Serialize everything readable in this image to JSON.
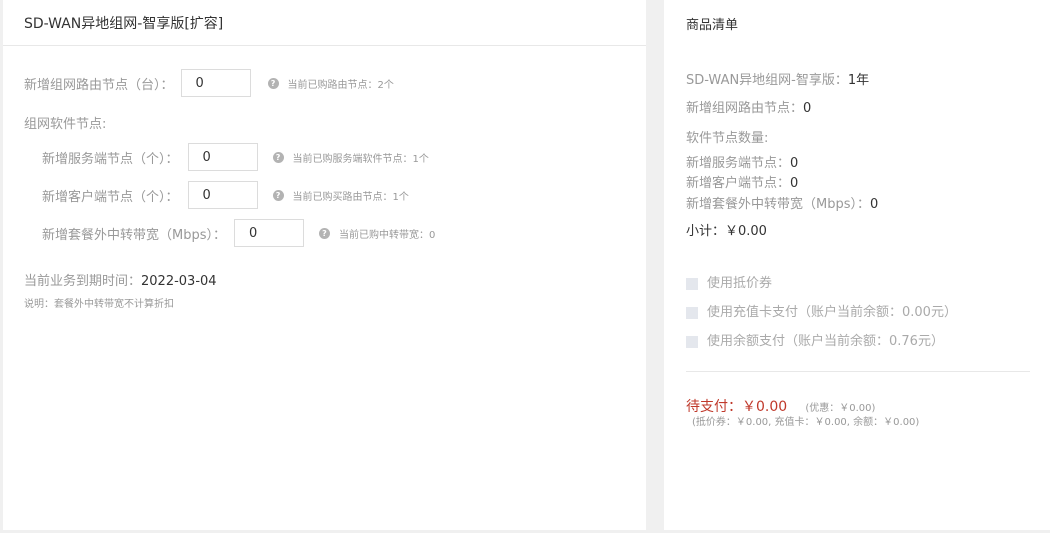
{
  "left": {
    "title": "SD-WAN异地组网-智享版[扩容]",
    "router_label": "新增组网路由节点（台）：",
    "router_value": "0",
    "router_hint": "当前已购路由节点：2个",
    "software_section": "组网软件节点:",
    "server_label": "新增服务端节点（个）：",
    "server_value": "0",
    "server_hint": "当前已购服务端软件节点：1个",
    "client_label": "新增客户端节点（个）：",
    "client_value": "0",
    "client_hint": "当前已购买路由节点：1个",
    "bandwidth_label": "新增套餐外中转带宽（Mbps）：",
    "bandwidth_value": "0",
    "bandwidth_hint": "当前已购中转带宽：0",
    "expiry_label": "当前业务到期时间：",
    "expiry_value": "2022-03-04",
    "note": "说明：套餐外中转带宽不计算折扣",
    "help_glyph": "?"
  },
  "right": {
    "title": "商品清单",
    "product_label": "SD-WAN异地组网-智享版：",
    "product_value": "1年",
    "router_label": "新增组网路由节点：",
    "router_value": "0",
    "software_label": "软件节点数量:",
    "server_label": "新增服务端节点：",
    "server_value": "0",
    "client_label": "新增客户端节点：",
    "client_value": "0",
    "bandwidth_label": "新增套餐外中转带宽（Mbps）：",
    "bandwidth_value": "0",
    "subtotal": "小计：￥0.00",
    "voucher_label": "使用抵价券",
    "card_label": "使用充值卡支付（账户当前余额：0.00元）",
    "balance_label": "使用余额支付（账户当前余额：0.76元）",
    "pay_label": "待支付：",
    "pay_value": "￥0.00",
    "discount": "(优惠：￥0.00)",
    "breakdown": "(抵价券：￥0.00, 充值卡：￥0.00, 余额：￥0.00)"
  },
  "colors": {
    "accent_red": "#c0392b",
    "checkbox": "#e4e7ed"
  }
}
